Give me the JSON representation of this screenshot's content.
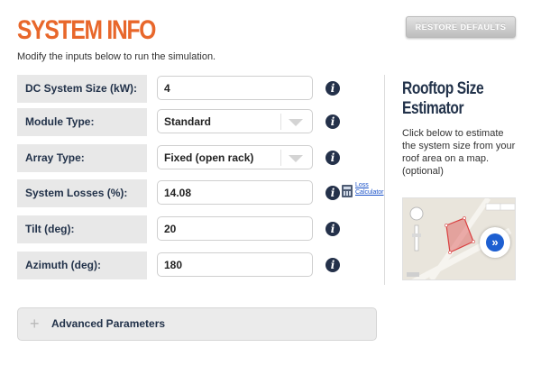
{
  "header": {
    "title": "SYSTEM INFO",
    "subtitle": "Modify the inputs below to run the simulation.",
    "restore_label": "RESTORE DEFAULTS"
  },
  "form": {
    "dc_size": {
      "label": "DC System Size (kW):",
      "value": "4"
    },
    "module_type": {
      "label": "Module Type:",
      "value": "Standard"
    },
    "array_type": {
      "label": "Array Type:",
      "value": "Fixed (open rack)"
    },
    "losses": {
      "label": "System Losses (%):",
      "value": "14.08",
      "link_line1": "Loss",
      "link_line2": "Calculator"
    },
    "tilt": {
      "label": "Tilt (deg):",
      "value": "20"
    },
    "azimuth": {
      "label": "Azimuth (deg):",
      "value": "180"
    },
    "info_glyph": "i"
  },
  "sidebar": {
    "title": "Rooftop Size Estimator",
    "text": "Click below to estimate the system size from your roof area on a map. (optional)",
    "map_button_glyph": "»"
  },
  "advanced": {
    "plus": "+",
    "label": "Advanced Parameters"
  },
  "colors": {
    "title": "#e8672b",
    "label_bg": "#e8e8e8",
    "info_icon": "#24314a",
    "map_button": "#1d5fd1"
  },
  "icons": {
    "info": "info-icon",
    "dropdown": "chevron-down-icon",
    "calculator": "calculator-icon",
    "map_next": "chevron-right-double-icon",
    "expand": "plus-icon"
  }
}
